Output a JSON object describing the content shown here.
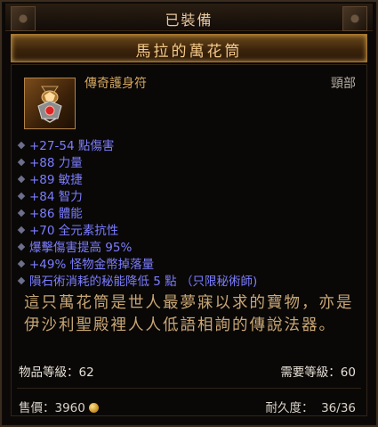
{
  "header": {
    "title": "已裝備"
  },
  "item": {
    "name": "馬拉的萬花筒",
    "type": "傳奇護身符",
    "slot": "頸部",
    "icon": "amulet-icon",
    "affixes": [
      "+27-54 點傷害",
      "+88 力量",
      "+89 敏捷",
      "+84 智力",
      "+86 體能",
      "+70 全元素抗性",
      "爆擊傷害提高 95%",
      "+49% 怪物金幣掉落量",
      "隕石術消耗的秘能降低 5 點 （只限秘術師)"
    ],
    "flavor_text": "這只萬花筒是世人最夢寐以求的寶物，亦是伊沙利聖殿裡人人低語相詢的傳說法器。",
    "item_level_label": "物品等級：62",
    "required_level_label": "需要等級：60"
  },
  "footer": {
    "price_label": "售價：3960",
    "durability_label": "耐久度：",
    "durability_value": "36/36"
  },
  "colors": {
    "affix": "#7b7dff",
    "item_type": "#d4a55e",
    "flavor": "#c9a775",
    "name": "#f4c98a"
  }
}
